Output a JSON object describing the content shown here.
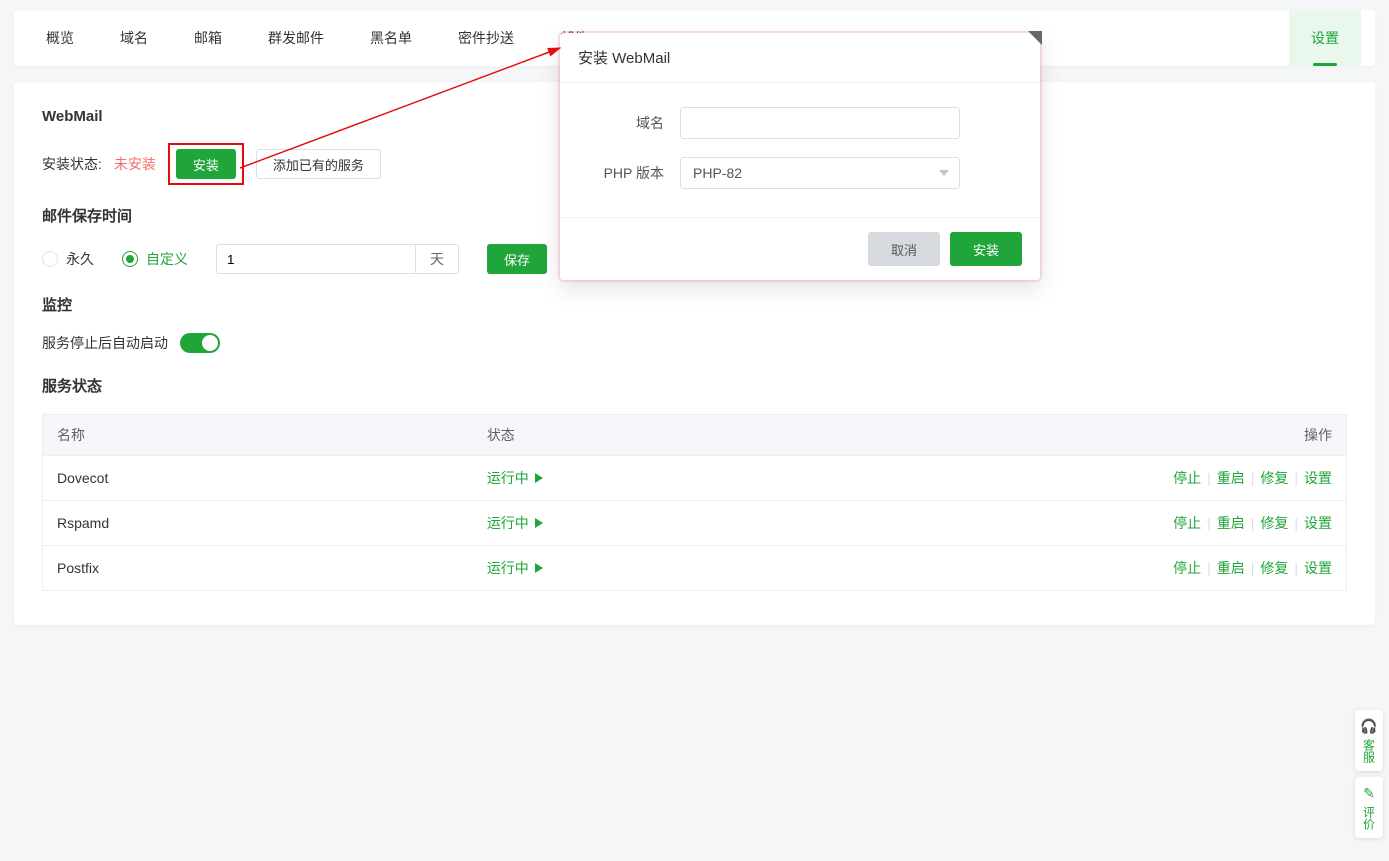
{
  "tabs": {
    "overview": "概览",
    "domain": "域名",
    "mailbox": "邮箱",
    "bulk": "群发邮件",
    "blacklist": "黑名单",
    "bcc": "密件抄送",
    "mail": "邮件",
    "settings": "设置"
  },
  "webmail": {
    "title": "WebMail",
    "status_label": "安装状态:",
    "status_value": "未安装",
    "install_btn": "安装",
    "add_existing_btn": "添加已有的服务"
  },
  "retention": {
    "title": "邮件保存时间",
    "forever_label": "永久",
    "custom_label": "自定义",
    "value": "1",
    "unit": "天",
    "save_btn": "保存"
  },
  "monitor": {
    "title": "监控",
    "auto_restart_label": "服务停止后自动启动"
  },
  "svcstatus": {
    "title": "服务状态",
    "cols": {
      "name": "名称",
      "status": "状态",
      "op": "操作"
    },
    "running": "运行中",
    "ops": {
      "stop": "停止",
      "restart": "重启",
      "repair": "修复",
      "settings": "设置"
    },
    "rows": [
      {
        "name": "Dovecot"
      },
      {
        "name": "Rspamd"
      },
      {
        "name": "Postfix"
      }
    ]
  },
  "dialog": {
    "title": "安装 WebMail",
    "domain_label": "域名",
    "domain_value": "",
    "php_label": "PHP 版本",
    "php_value": "PHP-82",
    "cancel": "取消",
    "confirm": "安装"
  },
  "float": {
    "support": "客服",
    "feedback": "评价"
  }
}
